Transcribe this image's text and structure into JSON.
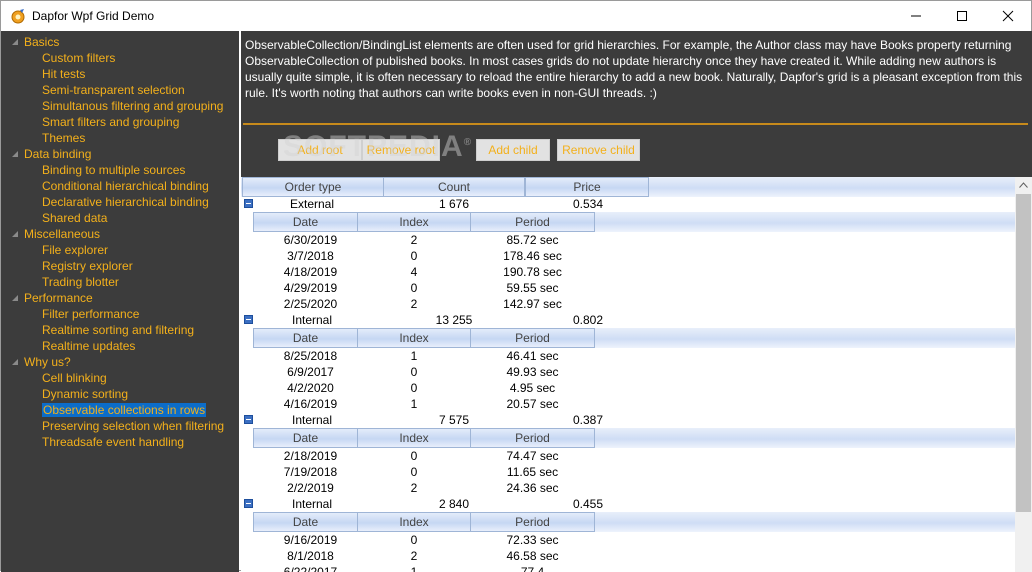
{
  "window": {
    "title": "Dapfor Wpf Grid Demo"
  },
  "sidebar": {
    "groups": [
      {
        "label": "Basics",
        "items": [
          "Custom filters",
          "Hit tests",
          "Semi-transparent selection",
          "Simultanous filtering and grouping",
          "Smart filters and grouping",
          "Themes"
        ]
      },
      {
        "label": "Data binding",
        "items": [
          "Binding to multiple sources",
          "Conditional hierarchical binding",
          "Declarative hierarchical binding",
          "Shared data"
        ]
      },
      {
        "label": "Miscellaneous",
        "items": [
          "File explorer",
          "Registry explorer",
          "Trading blotter"
        ]
      },
      {
        "label": "Performance",
        "items": [
          "Filter performance",
          "Realtime sorting and filtering",
          "Realtime updates"
        ]
      },
      {
        "label": "Why us?",
        "items": [
          "Cell blinking",
          "Dynamic sorting",
          "Observable collections in rows",
          "Preserving selection when filtering",
          "Threadsafe event handling"
        ]
      }
    ],
    "selected": "Observable collections in rows"
  },
  "description": "ObservableCollection/BindingList elements are often used for grid hierarchies. For example, the Author class may have Books property returning ObservableCollection of published books. In most cases grids do not update hierarchy once they have created it. While adding new authors is usually quite simple, it is often necessary to reload the entire hierarchy to add a new book. Naturally, Dapfor's grid is a pleasant exception from this rule. It's worth noting that authors can write books even in non-GUI threads. :)",
  "toolbar": {
    "add_root": "Add root",
    "remove_root": "Remove root",
    "add_child": "Add child",
    "remove_child": "Remove child",
    "watermark": "SOFTPEDIA",
    "watermark_mark": "®"
  },
  "grid": {
    "columns": [
      "Order type",
      "Count",
      "Price"
    ],
    "child_columns": [
      "Date",
      "Index",
      "Period"
    ],
    "groups": [
      {
        "type": "External",
        "count": "1 676",
        "price": "0.534",
        "rows": [
          [
            "6/30/2019",
            "2",
            "85.72 sec"
          ],
          [
            "3/7/2018",
            "0",
            "178.46 sec"
          ],
          [
            "4/18/2019",
            "4",
            "190.78 sec"
          ],
          [
            "4/29/2019",
            "0",
            "59.55 sec"
          ],
          [
            "2/25/2020",
            "2",
            "142.97 sec"
          ]
        ]
      },
      {
        "type": "Internal",
        "count": "13 255",
        "price": "0.802",
        "rows": [
          [
            "8/25/2018",
            "1",
            "46.41 sec"
          ],
          [
            "6/9/2017",
            "0",
            "49.93 sec"
          ],
          [
            "4/2/2020",
            "0",
            "4.95 sec"
          ],
          [
            "4/16/2019",
            "1",
            "20.57 sec"
          ]
        ]
      },
      {
        "type": "Internal",
        "count": "7 575",
        "price": "0.387",
        "rows": [
          [
            "2/18/2019",
            "0",
            "74.47 sec"
          ],
          [
            "7/19/2018",
            "0",
            "11.65 sec"
          ],
          [
            "2/2/2019",
            "2",
            "24.36 sec"
          ]
        ]
      },
      {
        "type": "Internal",
        "count": "2 840",
        "price": "0.455",
        "rows": [
          [
            "9/16/2019",
            "0",
            "72.33 sec"
          ],
          [
            "8/1/2018",
            "2",
            "46.58 sec"
          ],
          [
            "6/22/2017",
            "1",
            "77.4"
          ]
        ]
      }
    ]
  },
  "colors": {
    "accent": "#f3b01b",
    "sidebar_bg": "#3c3c3c",
    "selection": "#0c6dc9"
  }
}
